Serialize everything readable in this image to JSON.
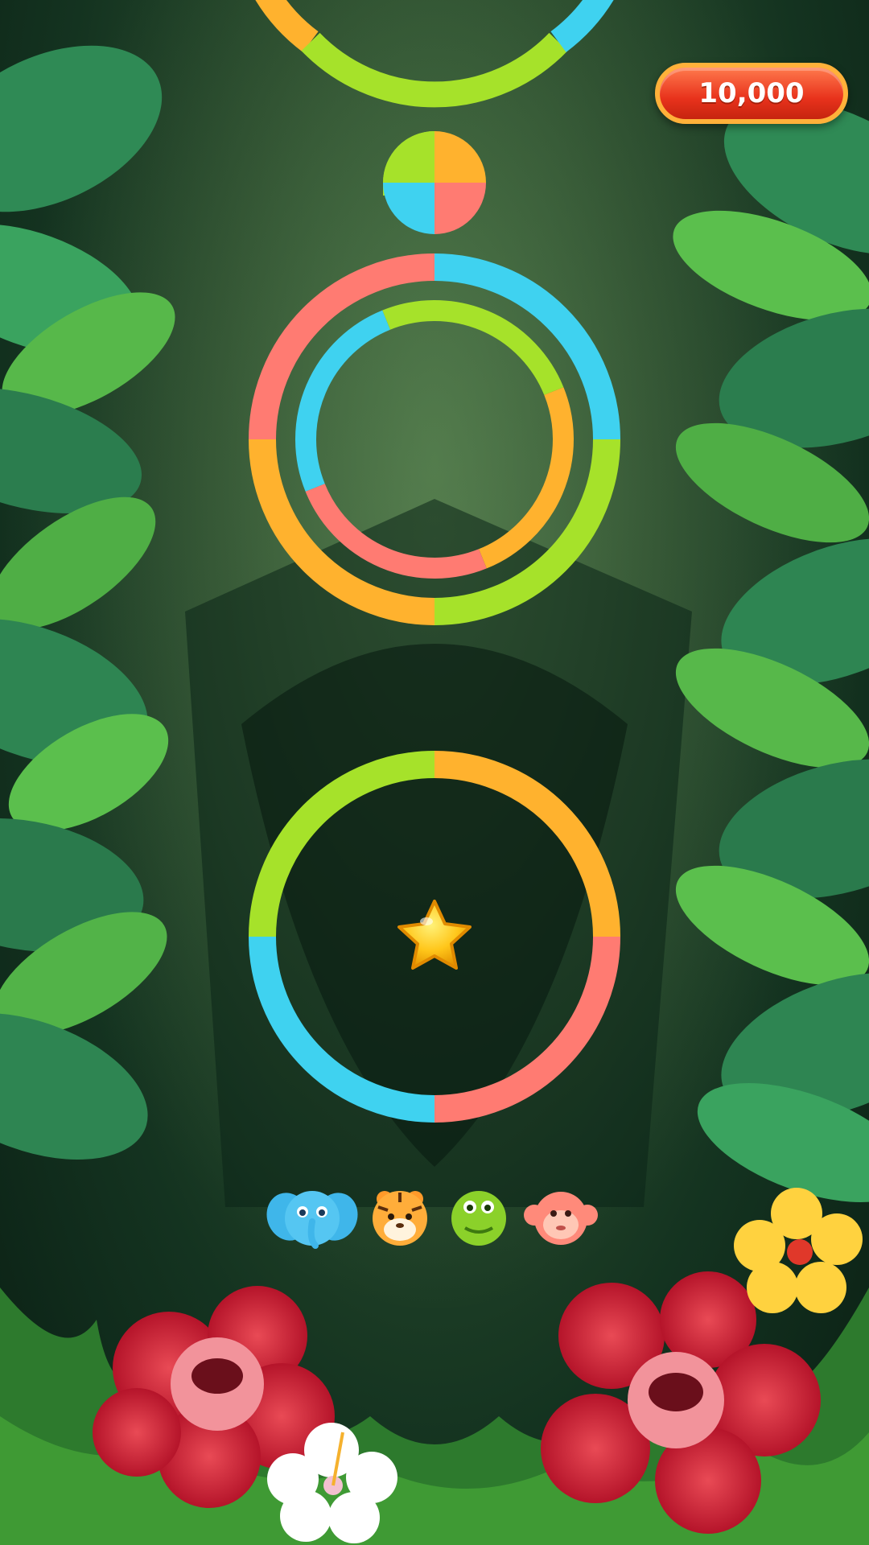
{
  "hud": {
    "score": "10,000"
  },
  "colors": {
    "green": "#a6e22a",
    "yellow": "#ffb22e",
    "cyan": "#3fd2f0",
    "pink": "#ff7b72"
  },
  "game": {
    "player_ball": {
      "quadrants": [
        "green",
        "yellow",
        "cyan",
        "pink"
      ]
    },
    "rings": [
      {
        "name": "top-ring-partial",
        "segments": [
          "yellow",
          "green",
          "cyan"
        ]
      },
      {
        "name": "outer-ring",
        "segments": [
          "cyan",
          "green",
          "yellow",
          "pink"
        ]
      },
      {
        "name": "inner-ring",
        "segments": [
          "green",
          "yellow",
          "pink",
          "cyan"
        ]
      },
      {
        "name": "lower-ring",
        "segments": [
          "yellow",
          "pink",
          "cyan",
          "green"
        ]
      }
    ],
    "star_pickup": "star-icon",
    "color_switchers": [
      "elephant-icon",
      "tiger-icon",
      "snake-icon",
      "monkey-icon"
    ]
  }
}
